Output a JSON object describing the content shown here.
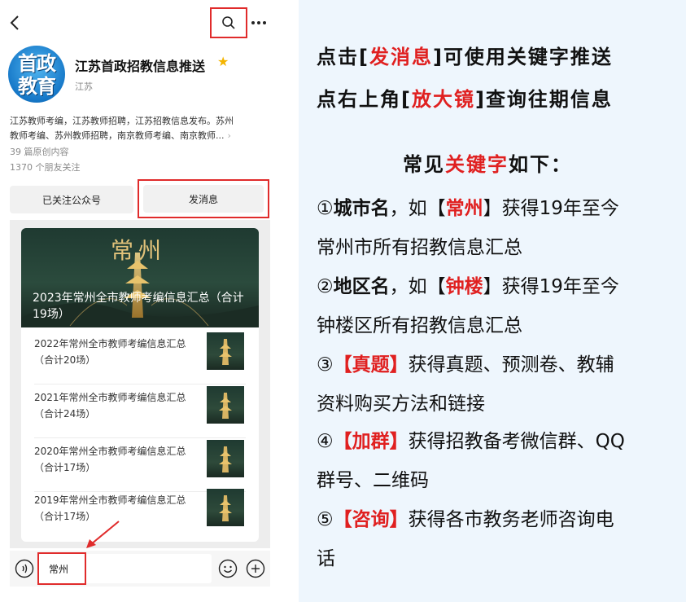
{
  "phone": {
    "account": {
      "avatar_line1": "首政",
      "avatar_line2": "教育",
      "name": "江苏首政招教信息推送",
      "region": "江苏",
      "description_line1": "江苏教师考编，江苏教师招聘，江苏招教信息发布。苏州",
      "description_line2": "教师考编、苏州教师招聘，南京教师考编、南京教师...",
      "original_count": "39 篇原创内容",
      "friends_following": "1370 个朋友关注"
    },
    "buttons": {
      "followed": "已关注公众号",
      "send_message": "发消息"
    },
    "feed": {
      "hero_city": "常州",
      "hero_title": "2023年常州全市教师考编信息汇总（合计19场）",
      "articles": [
        {
          "title": "2022年常州全市教师考编信息汇总（合计20场）"
        },
        {
          "title": "2021年常州全市教师考编信息汇总（合计24场）"
        },
        {
          "title": "2020年常州全市教师考编信息汇总（合计17场）"
        },
        {
          "title": "2019年常州全市教师考编信息汇总（合计17场）"
        }
      ]
    },
    "input": {
      "value": "常州"
    }
  },
  "info": {
    "line1": {
      "a": "点击[",
      "b": "发消息",
      "c": "]可使用关键字推送"
    },
    "line2": {
      "a": "点右上角[",
      "b": "放大镜",
      "c": "]查询往期信息"
    },
    "line3": {
      "a": "常见",
      "b": "关键字",
      "c": "如下："
    },
    "item1": {
      "num": "①",
      "key": "城市名",
      "mid": "，如【",
      "ex": "常州",
      "tail": "】获得19年至今",
      "line2": "常州市所有招教信息汇总"
    },
    "item2": {
      "num": "②",
      "key": "地区名",
      "mid": "，如【",
      "ex": "钟楼",
      "tail": "】获得19年至今",
      "line2": "钟楼区所有招教信息汇总"
    },
    "item3": {
      "num": "③",
      "open": "【",
      "key": "真题",
      "close": "】",
      "tail": "获得真题、预测卷、教辅",
      "line2": "资料购买方法和链接"
    },
    "item4": {
      "num": "④",
      "open": "【",
      "key": "加群",
      "close": "】",
      "tail": "获得招教备考微信群、QQ",
      "line2": "群号、二维码"
    },
    "item5": {
      "num": "⑤",
      "open": "【",
      "key": "咨询",
      "close": "】",
      "tail": "获得各市教务老师咨询电",
      "line2": "话"
    }
  },
  "colors": {
    "highlight_red": "#e02020",
    "box_red": "#e02b2b",
    "panel_bg": "#eef6fd"
  }
}
